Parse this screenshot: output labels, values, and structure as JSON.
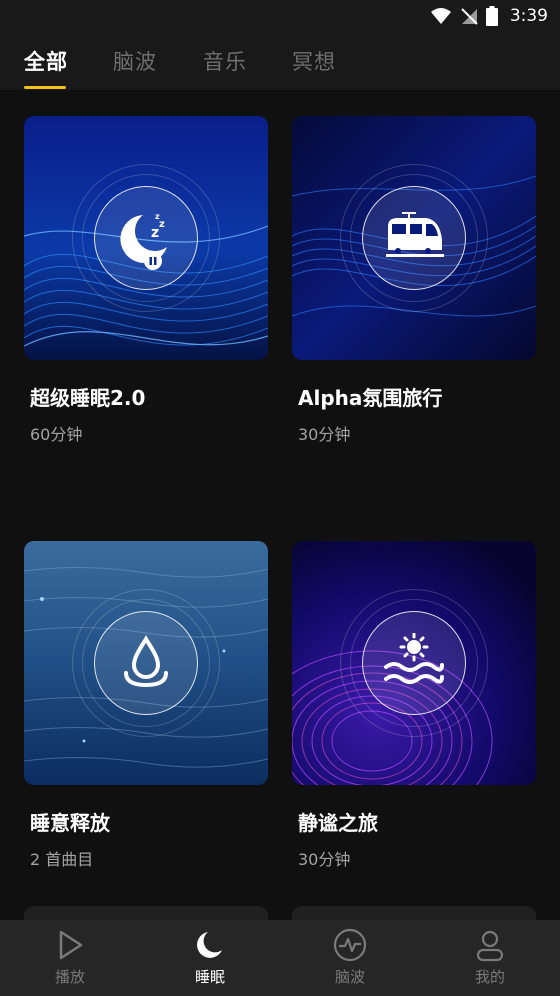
{
  "status_bar": {
    "time": "3:39",
    "icons": [
      "wifi-icon",
      "no-signal-icon",
      "battery-icon"
    ]
  },
  "tabs": [
    {
      "label": "全部",
      "active": true
    },
    {
      "label": "脑波",
      "active": false
    },
    {
      "label": "音乐",
      "active": false
    },
    {
      "label": "冥想",
      "active": false
    }
  ],
  "cards": [
    {
      "title": "超级睡眠2.0",
      "subtitle": "60分钟",
      "icon": "moon-sleep-icon"
    },
    {
      "title": "Alpha氛围旅行",
      "subtitle": "30分钟",
      "icon": "train-icon"
    },
    {
      "title": "睡意释放",
      "subtitle": "2 首曲目",
      "icon": "water-drop-icon"
    },
    {
      "title": "静谧之旅",
      "subtitle": "30分钟",
      "icon": "sun-waves-icon"
    }
  ],
  "bottom_nav": [
    {
      "label": "播放",
      "icon": "play-icon",
      "active": false
    },
    {
      "label": "睡眠",
      "icon": "moon-icon",
      "active": true
    },
    {
      "label": "脑波",
      "icon": "pulse-icon",
      "active": false
    },
    {
      "label": "我的",
      "icon": "user-icon",
      "active": false
    }
  ],
  "colors": {
    "accent": "#f2c21b",
    "background": "#101010",
    "header": "#191919",
    "nav": "#262626"
  }
}
